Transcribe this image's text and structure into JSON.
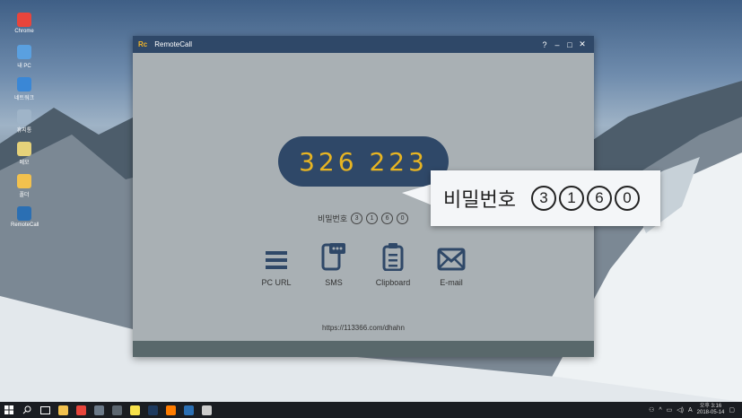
{
  "window": {
    "title": "RemoteCall",
    "logo": "Rc",
    "controls": {
      "help": "?",
      "minimize": "–",
      "maximize": "□",
      "close": "✕"
    }
  },
  "session": {
    "code": "326 223",
    "password_label": "비밀번호",
    "password_digits": [
      "3",
      "1",
      "6",
      "0"
    ]
  },
  "tools": [
    {
      "label": "PC URL",
      "icon": "menu-lines-icon"
    },
    {
      "label": "SMS",
      "icon": "phone-chat-icon"
    },
    {
      "label": "Clipboard",
      "icon": "clipboard-icon"
    },
    {
      "label": "E-mail",
      "icon": "envelope-icon"
    }
  ],
  "url": "https://113366.com/dhahn",
  "callout": {
    "label": "비밀번호",
    "digits": [
      "3",
      "1",
      "6",
      "0"
    ]
  },
  "desktop_icons": [
    {
      "label": "Chrome",
      "color": "#e8453c"
    },
    {
      "label": "내 PC",
      "color": "#5aa0e0"
    },
    {
      "label": "네트워크",
      "color": "#3a87d6"
    },
    {
      "label": "휴지통",
      "color": "#9fb4c8"
    },
    {
      "label": "메모",
      "color": "#e6d27a"
    },
    {
      "label": "폴더",
      "color": "#f2c14e"
    },
    {
      "label": "RemoteCall",
      "color": "#2b6fb3"
    }
  ],
  "taskbar": {
    "apps": [
      {
        "name": "file-explorer",
        "color": "#f2c14e"
      },
      {
        "name": "chrome",
        "color": "#e8453c"
      },
      {
        "name": "app",
        "color": "#6c7a89"
      },
      {
        "name": "calculator",
        "color": "#5c6670"
      },
      {
        "name": "kakaotalk",
        "color": "#f7e14b"
      },
      {
        "name": "photoshop",
        "color": "#1e3a5f"
      },
      {
        "name": "illustrator",
        "color": "#ff7c00"
      },
      {
        "name": "remotecall",
        "color": "#2b6fb3"
      },
      {
        "name": "settings",
        "color": "#cccccc"
      }
    ],
    "tray_lang": "A",
    "time": "오후 3:16",
    "date": "2018-05-14"
  }
}
